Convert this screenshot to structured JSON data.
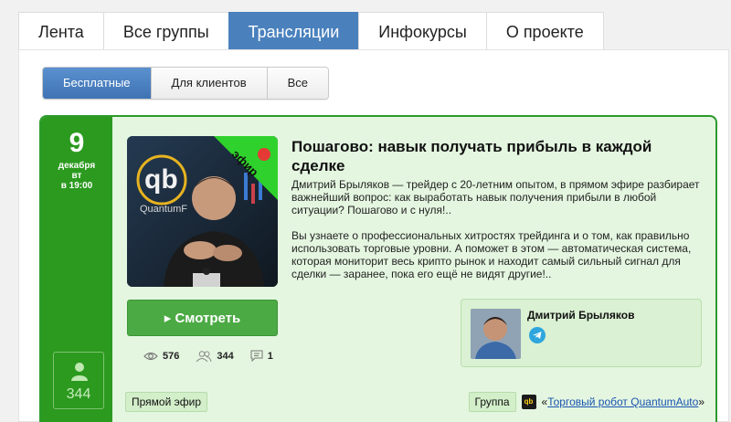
{
  "nav": {
    "tabs": [
      {
        "label": "Лента"
      },
      {
        "label": "Все группы"
      },
      {
        "label": "Трансляции"
      },
      {
        "label": "Инфокурсы"
      },
      {
        "label": "О проекте"
      }
    ],
    "active": "Трансляции"
  },
  "subnav": {
    "tabs": [
      {
        "label": "Бесплатные"
      },
      {
        "label": "Для клиентов"
      },
      {
        "label": "Все"
      }
    ],
    "active": "Бесплатные"
  },
  "event": {
    "day": "9",
    "month": "декабря",
    "weekday": "вт",
    "time": "в 19:00",
    "viewers": "344",
    "badge": "эфир",
    "thumb_logo": "qb",
    "thumb_brand": "QuantumF",
    "title": "Пошагово: навык получать прибыль в каждой сделке",
    "description_1": "Дмитрий Брыляков — трейдер с 20-летним опытом, в прямом эфире разбирает важнейший вопрос: как выработать навык получения прибыли в любой ситуации? Пошагово и с нуля!..",
    "description_2": "Вы узнаете о профессиональных хитростях трейдинга и о том, как правильно использовать торговые уровни. А поможет в этом — автоматическая система, которая мониторит весь крипто рынок и находит самый сильный сигнал для сделки — заранее, пока его ещё не видят другие!..",
    "watch_label": "▸ Смотреть",
    "stats": {
      "views": "576",
      "participants": "344",
      "comments": "1"
    },
    "author_name": "Дмитрий Брыляков",
    "live_label": "Прямой эфир",
    "group_label": "Группа",
    "group_logo": "qb",
    "group_quote_open": "«",
    "group_name": "Торговый робот QuantumAuto",
    "group_quote_close": "»"
  },
  "colors": {
    "nav_active": "#4a81bd",
    "card_green": "#2b9a1f",
    "card_bg": "#e4f6e0",
    "button_green": "#4caa44",
    "telegram": "#2ea6dd",
    "badge_green": "#2fd12c",
    "live_dot": "#e53935"
  }
}
